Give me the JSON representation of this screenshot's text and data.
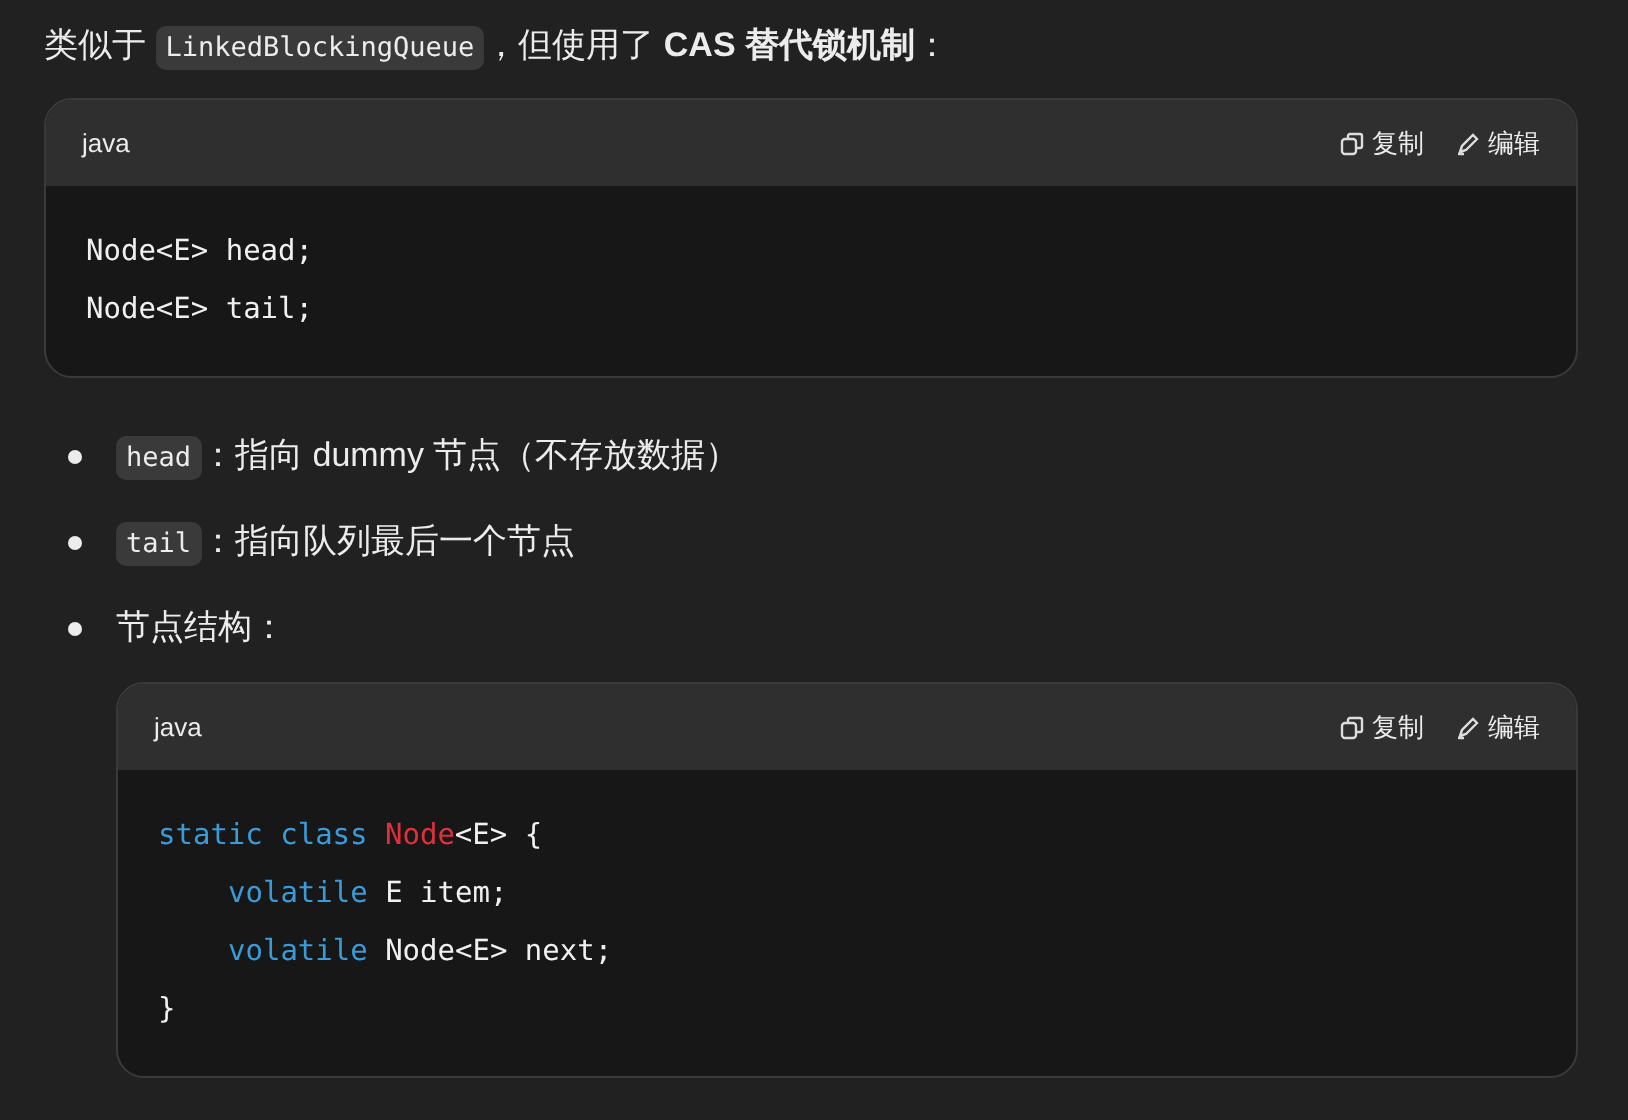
{
  "intro": [
    {
      "kind": "text",
      "text": "类似于 "
    },
    {
      "kind": "code",
      "text": "LinkedBlockingQueue"
    },
    {
      "kind": "text",
      "text": "，但使用了 **CAS 替代锁机制**："
    }
  ],
  "code_block": {
    "language": "java",
    "actions": [
      {
        "kind": "copy",
        "label": "复制"
      },
      {
        "kind": "edit",
        "label": "编辑"
      }
    ],
    "lines": [
      {
        "indented": false,
        "tokens": [
          {
            "kind": "plain",
            "text": "Node<E> head;"
          }
        ]
      },
      {
        "indented": false,
        "tokens": [
          {
            "kind": "plain",
            "text": "Node<E> tail;"
          }
        ]
      }
    ]
  },
  "bullets": [
    {
      "segments": [
        {
          "kind": "code",
          "text": "head"
        },
        {
          "kind": "text",
          "text": "：指向 dummy 节点（不存放数据）"
        }
      ]
    },
    {
      "segments": [
        {
          "kind": "code",
          "text": "tail"
        },
        {
          "kind": "text",
          "text": "：指向队列最后一个节点"
        }
      ]
    },
    {
      "segments": [
        {
          "kind": "text",
          "text": "节点结构："
        }
      ],
      "code_block": {
        "language": "java",
        "actions": [
          {
            "kind": "copy",
            "label": "复制"
          },
          {
            "kind": "edit",
            "label": "编辑"
          }
        ],
        "lines": [
          {
            "indented": false,
            "tokens": [
              {
                "kind": "keyword",
                "text": "static class "
              },
              {
                "kind": "class",
                "text": "Node"
              },
              {
                "kind": "plain",
                "text": "<E> {"
              }
            ]
          },
          {
            "indented": true,
            "tokens": [
              {
                "kind": "keyword",
                "text": "volatile "
              },
              {
                "kind": "plain",
                "text": "E item;"
              }
            ]
          },
          {
            "indented": true,
            "tokens": [
              {
                "kind": "keyword",
                "text": "volatile "
              },
              {
                "kind": "plain",
                "text": "Node<E> next;"
              }
            ]
          },
          {
            "indented": false,
            "tokens": [
              {
                "kind": "plain",
                "text": "}"
              }
            ]
          }
        ]
      }
    }
  ]
}
